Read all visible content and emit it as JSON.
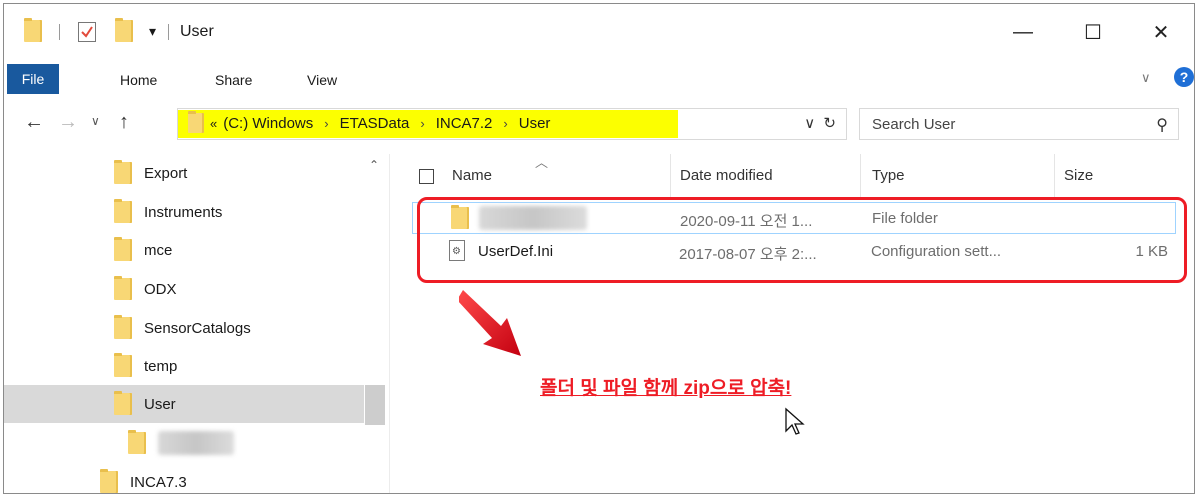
{
  "window": {
    "title": "User"
  },
  "ribbon": {
    "file": "File",
    "tabs": [
      "Home",
      "Share",
      "View"
    ]
  },
  "address": {
    "crumbs": [
      "«",
      "(C:) Windows",
      "ETASData",
      "INCA7.2",
      "User"
    ],
    "dropdown_glyph": "∨",
    "refresh_glyph": "↻"
  },
  "search": {
    "placeholder": "Search User"
  },
  "nav_tree": {
    "items": [
      "Export",
      "Instruments",
      "mce",
      "ODX",
      "SensorCatalogs",
      "temp",
      "User",
      "",
      "INCA7.3"
    ],
    "selected": "User"
  },
  "columns": {
    "name": "Name",
    "date": "Date modified",
    "type": "Type",
    "size": "Size"
  },
  "files": [
    {
      "name": "",
      "date": "2020-09-11 오전 1...",
      "type": "File folder",
      "size": ""
    },
    {
      "name": "UserDef.Ini",
      "date": "2017-08-07 오후 2:...",
      "type": "Configuration sett...",
      "size": "1 KB"
    }
  ],
  "annotation": {
    "note": "폴더 및 파일 함께 zip으로 압축!",
    "color": "#ee1c25"
  },
  "highlight_color": "#fcff00",
  "icons": [
    "folder-icon",
    "properties-icon",
    "pin-icon",
    "back-icon",
    "forward-icon",
    "up-icon",
    "search-icon",
    "help-icon",
    "refresh-icon",
    "ini-file-icon"
  ]
}
